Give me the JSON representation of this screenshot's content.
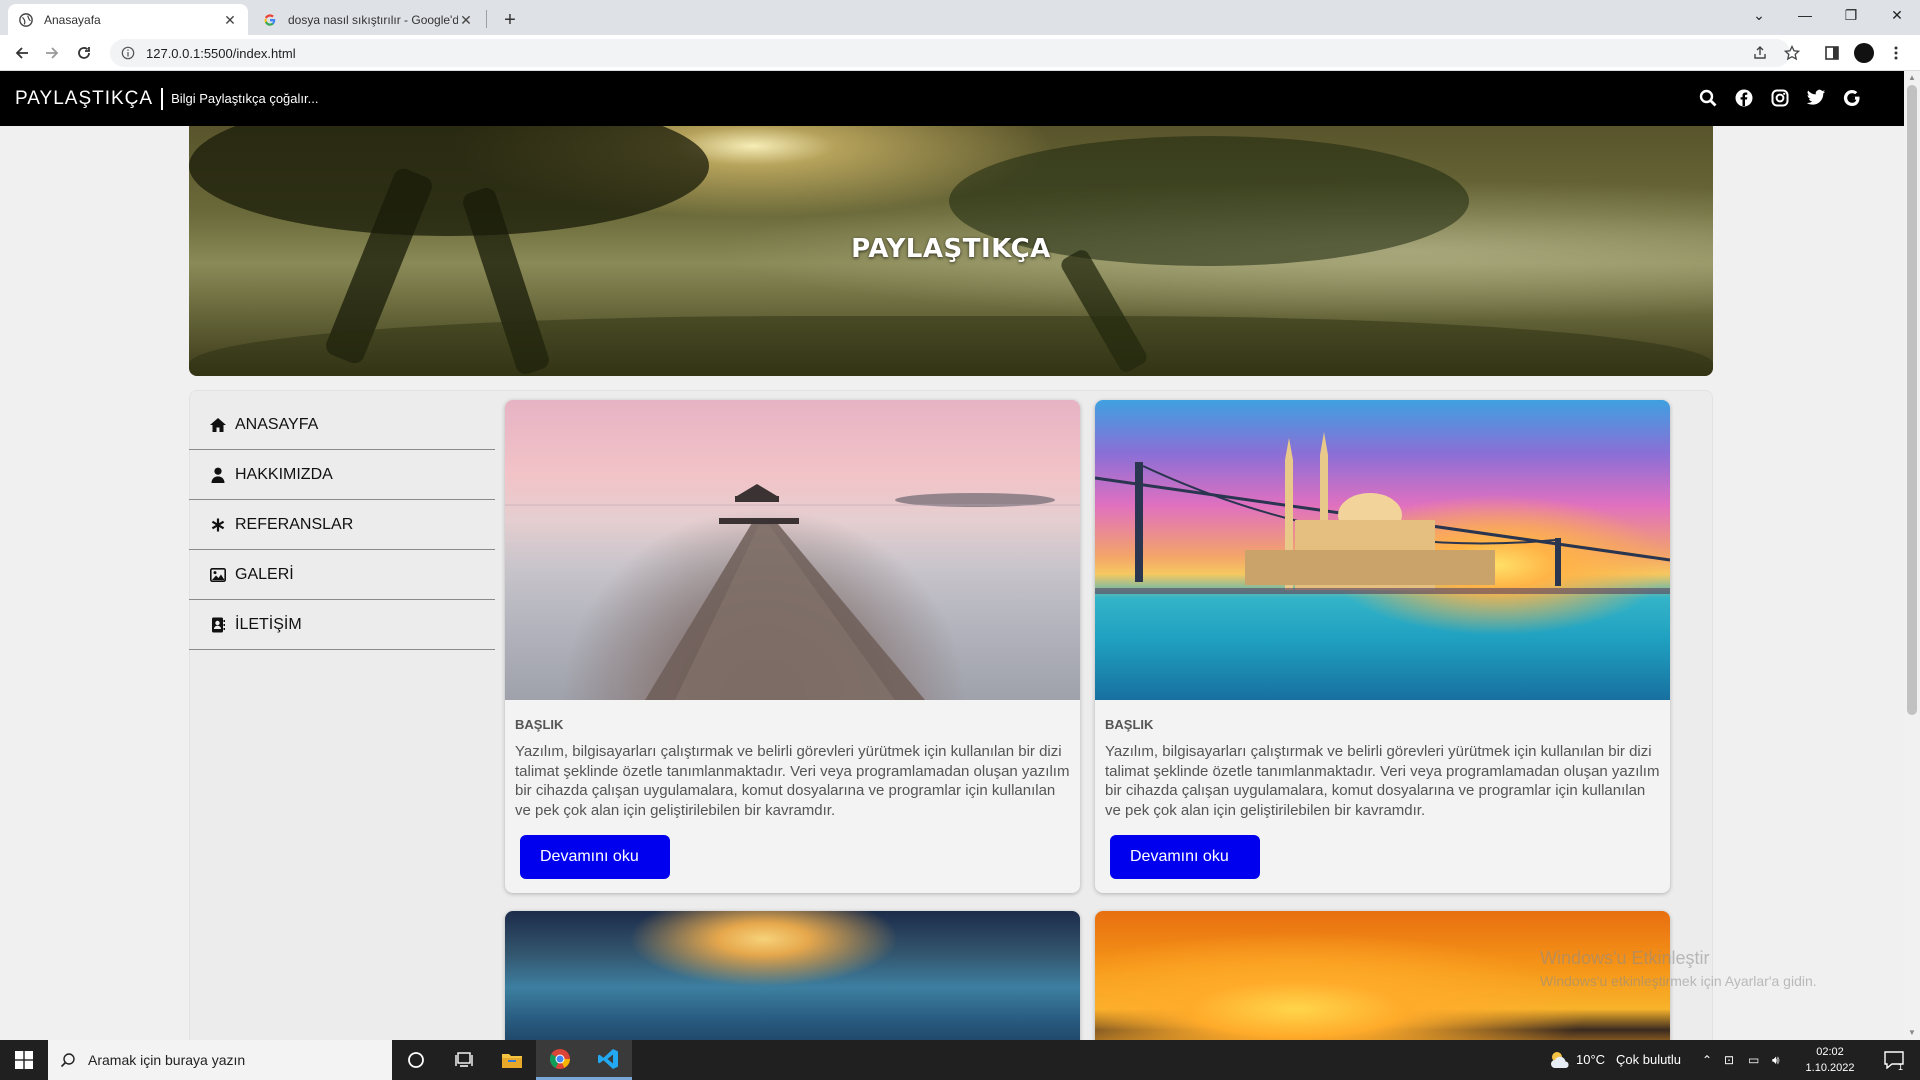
{
  "browser": {
    "tabs": [
      {
        "title": "Anasayafa",
        "active": true
      },
      {
        "title": "dosya nasıl sıkıştırılır - Google'da",
        "active": false
      }
    ],
    "url": "127.0.0.1:5500/index.html",
    "new_tab": "+"
  },
  "site": {
    "brand": "PAYLAŞTIKÇA",
    "tagline": "Bilgi Paylaştıkça çoğalır...",
    "hero_title": "PAYLAŞTIKÇA",
    "menu": [
      {
        "label": "ANASAYFA",
        "icon": "home-icon"
      },
      {
        "label": "HAKKIMIZDA",
        "icon": "user-icon"
      },
      {
        "label": "REFERANSLAR",
        "icon": "asterisk-icon"
      },
      {
        "label": "GALERİ",
        "icon": "image-icon"
      },
      {
        "label": "İLETİŞİM",
        "icon": "contact-book-icon"
      }
    ],
    "cards": [
      {
        "title": "BAŞLIK",
        "text": "Yazılım, bilgisayarları çalıştırmak ve belirli görevleri yürütmek için kullanılan bir dizi talimat şeklinde özetle tanımlanmaktadır. Veri veya programlamadan oluşan yazılım bir cihazda çalışan uygulamalara, komut dosyalarına ve programlar için kullanılan ve pek çok alan için geliştirilebilen bir kavramdır.",
        "button": "Devamını oku",
        "image": "pier-sunset"
      },
      {
        "title": "BAŞLIK",
        "text": "Yazılım, bilgisayarları çalıştırmak ve belirli görevleri yürütmek için kullanılan bir dizi talimat şeklinde özetle tanımlanmaktadır. Veri veya programlamadan oluşan yazılım bir cihazda çalışan uygulamalara, komut dosyalarına ve programlar için kullanılan ve pek çok alan için geliştirilebilen bir kavramdır.",
        "button": "Devamını oku",
        "image": "mosque-bridge-sunset"
      }
    ],
    "colors": {
      "header": "#000000",
      "button": "#0000ee",
      "text": "#555555"
    }
  },
  "watermark": {
    "line1": "Windows'u Etkinleştir",
    "line2": "Windows'u etkinleştirmek için Ayarlar'a gidin."
  },
  "taskbar": {
    "search_placeholder": "Aramak için buraya yazın",
    "weather_temp": "10°C",
    "weather_text": "Çok bulutlu",
    "time": "02:02",
    "date": "1.10.2022",
    "notification_count": "1"
  }
}
